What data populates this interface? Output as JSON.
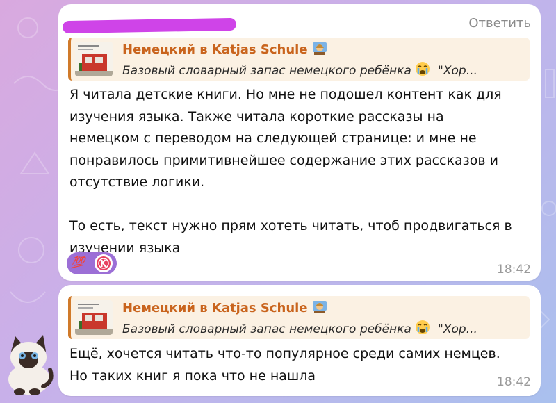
{
  "messages": [
    {
      "reply_label": "Ответить",
      "quote": {
        "title": "Немецкий в Katjas Schule",
        "text": "Базовый словарный запас немецкого ребёнка",
        "text_tail": "\"Хор..."
      },
      "text": "Я читала детские книги. Но мне не подошел контент как для\nизучения языка. Также читала короткие рассказы на\nнемецком с переводом на следующей странице: и мне не\nпонравилось примитивнейшее содержание этих рассказов и\nотсутствие логики.\n\nТо есть, текст нужно прям хотеть читать, чтоб продвигаться в\nизучении языка",
      "reaction": {
        "emoji": "💯"
      },
      "time": "18:42"
    },
    {
      "quote": {
        "title": "Немецкий в Katjas Schule",
        "text": "Базовый словарный запас немецкого ребёнка",
        "text_tail": "\"Хор..."
      },
      "text": "Ещё, хочется читать что-то популярное среди самих немцев.\nНо таких книг я пока что не нашла",
      "time": "18:42"
    }
  ],
  "colors": {
    "quote_accent": "#d07a2a",
    "quote_title": "#c9641d",
    "redaction": "#cf44e8",
    "reaction_bg": "#9c6fd6"
  }
}
